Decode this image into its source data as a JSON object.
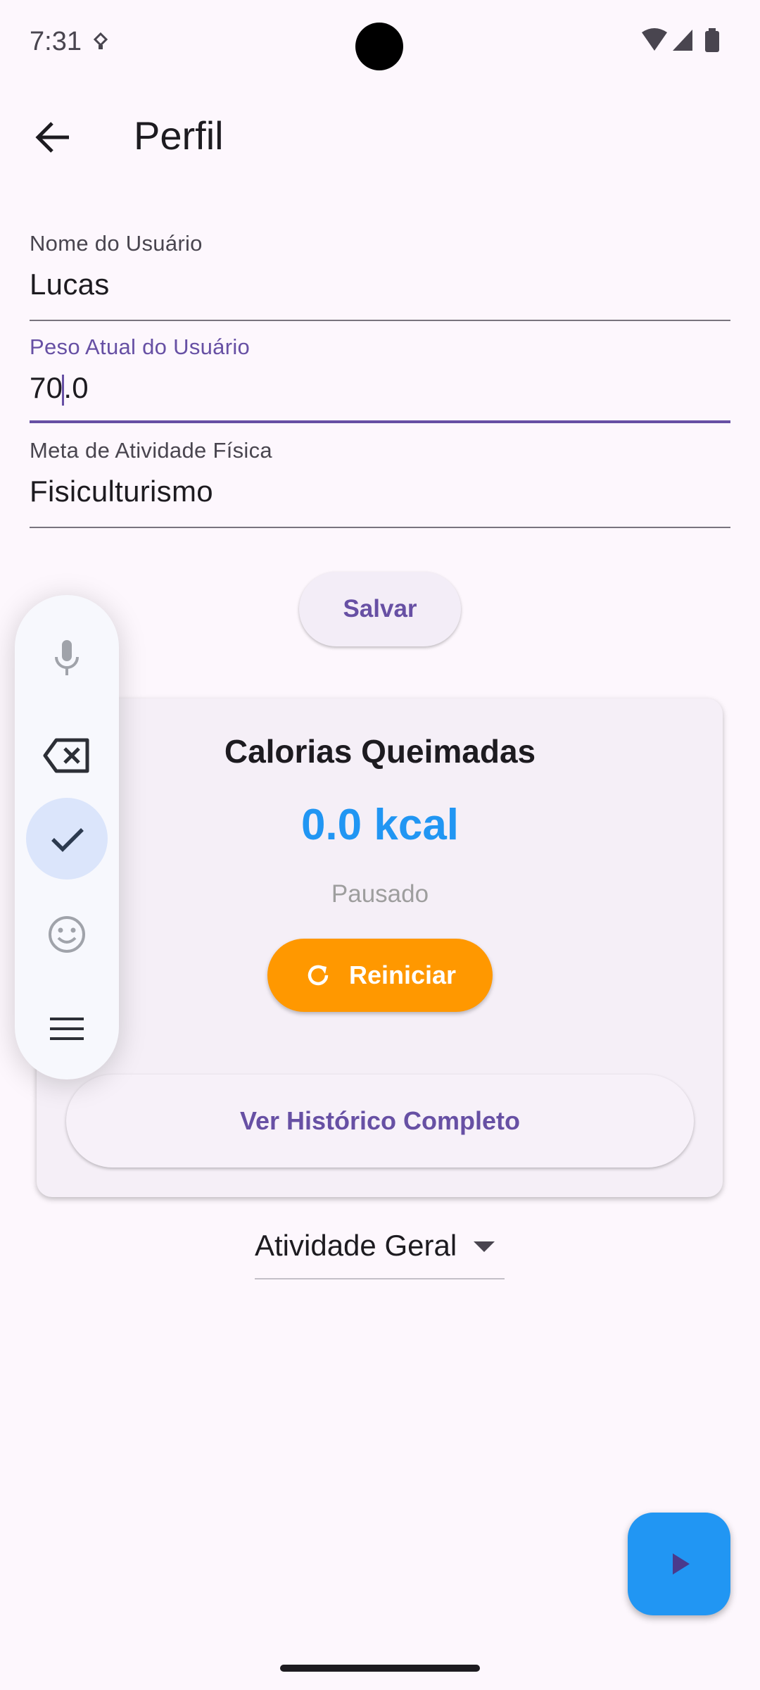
{
  "status_bar": {
    "time": "7:31"
  },
  "app_bar": {
    "title": "Perfil"
  },
  "fields": [
    {
      "label": "Nome do Usuário",
      "value": "Lucas"
    },
    {
      "label": "Peso Atual do Usuário",
      "value_before_caret": "70",
      "value_after_caret": ".0"
    },
    {
      "label": "Meta de Atividade Física",
      "value": "Fisiculturismo"
    }
  ],
  "save_button": {
    "label": "Salvar"
  },
  "calories_card": {
    "title": "Calorias Queimadas",
    "value": "0.0 kcal",
    "status": "Pausado",
    "restart_label": "Reiniciar",
    "history_label": "Ver Histórico Completo"
  },
  "dropdown": {
    "selected": "Atividade Geral"
  },
  "keyboard_toolbar": {
    "icons": [
      "microphone-icon",
      "backspace-icon",
      "check-icon",
      "emoji-icon",
      "menu-icon"
    ]
  },
  "fab": {
    "icon": "play-icon"
  },
  "colors": {
    "primary": "#6750a4",
    "accent_blue": "#2196f3",
    "accent_orange": "#ff9800",
    "background": "#fdf7fd"
  }
}
